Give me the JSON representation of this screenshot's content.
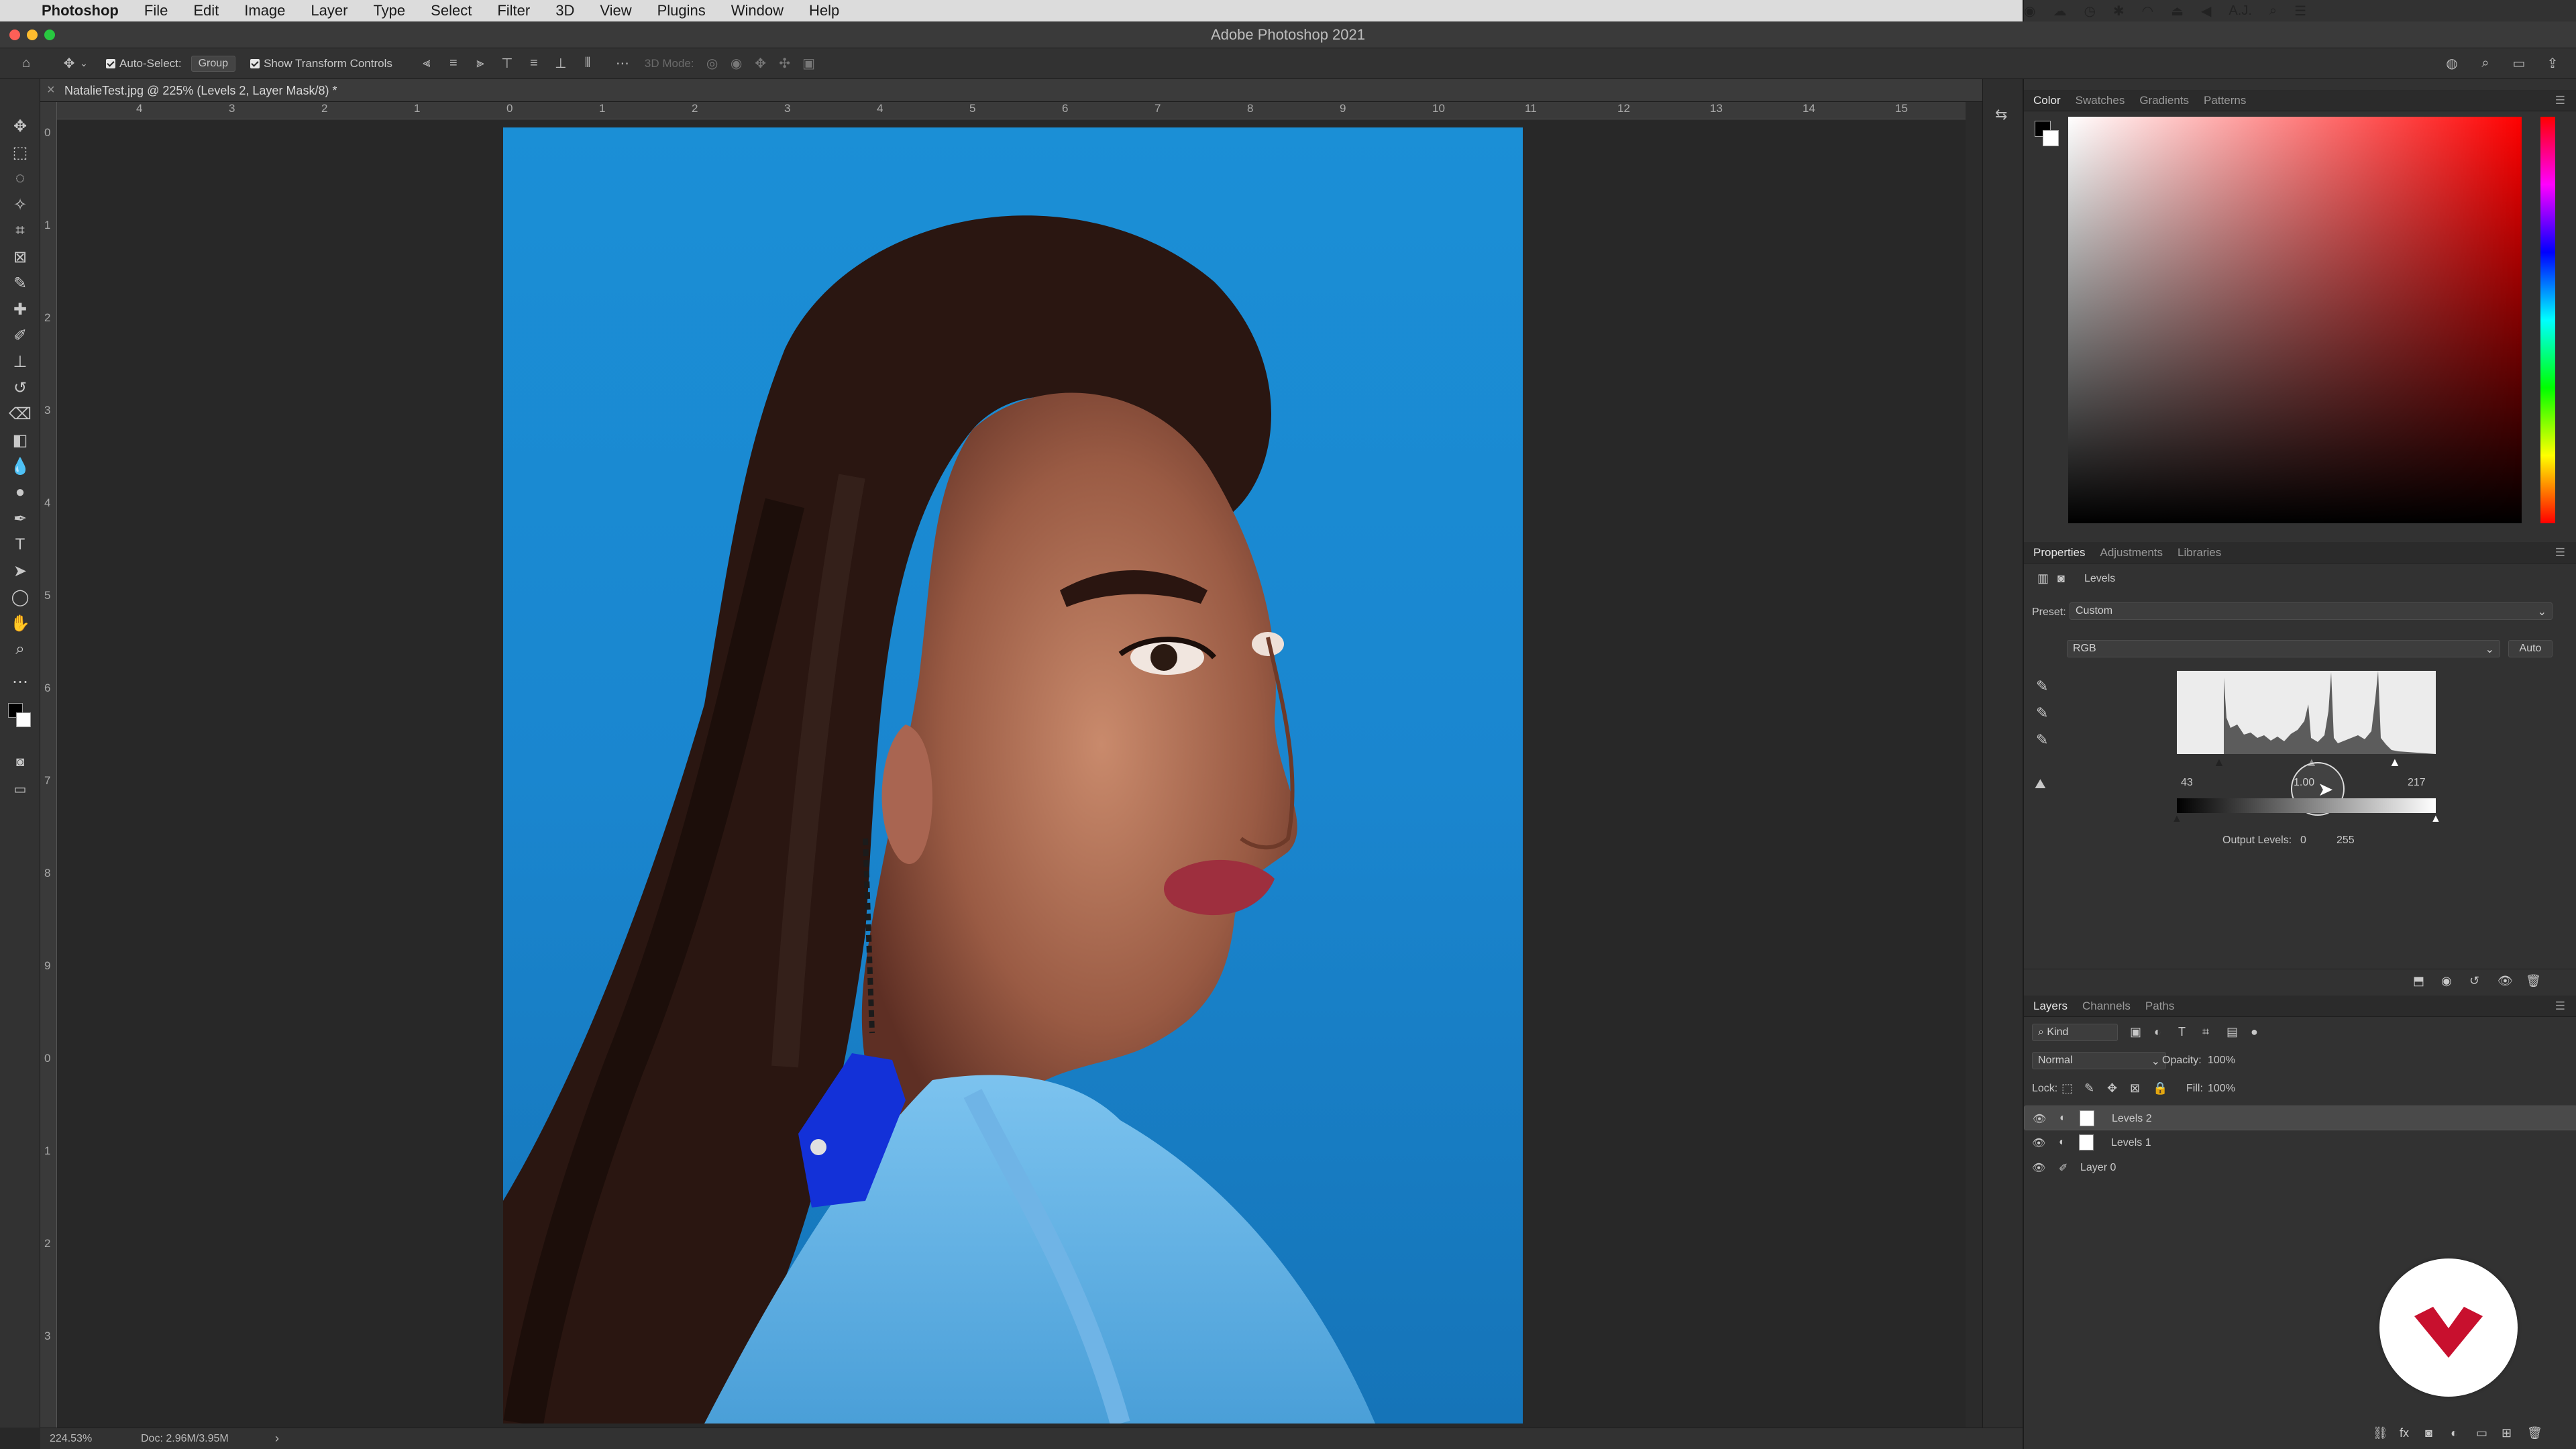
{
  "menubar": {
    "app_name": "Photoshop",
    "items": [
      "File",
      "Edit",
      "Image",
      "Layer",
      "Type",
      "Select",
      "Filter",
      "3D",
      "View",
      "Plugins",
      "Window",
      "Help"
    ],
    "user": "A.J."
  },
  "window": {
    "title": "Adobe Photoshop 2021"
  },
  "options_bar": {
    "auto_select_label": "Auto-Select:",
    "auto_select_target": "Group",
    "show_transform_label": "Show Transform Controls",
    "mode_3d_label": "3D Mode:"
  },
  "document": {
    "tab_title": "NatalieTest.jpg @ 225% (Levels 2, Layer Mask/8) *",
    "zoom": "224.53%",
    "doc_info": "Doc: 2.96M/3.95M"
  },
  "rulers": {
    "h": [
      "4",
      "3",
      "2",
      "1",
      "0",
      "1",
      "2",
      "3",
      "4",
      "5",
      "6",
      "7",
      "8",
      "9",
      "10",
      "11",
      "12",
      "13",
      "14",
      "15"
    ],
    "v": [
      "0",
      "1",
      "2",
      "3",
      "4",
      "5",
      "6",
      "7",
      "8",
      "9",
      "0",
      "1",
      "2",
      "3"
    ]
  },
  "color_panel": {
    "tabs": [
      "Color",
      "Swatches",
      "Gradients",
      "Patterns"
    ],
    "active_tab": "Color",
    "hue_color": "#ff0000"
  },
  "properties_panel": {
    "tabs": [
      "Properties",
      "Adjustments",
      "Libraries"
    ],
    "active_tab": "Properties",
    "adjustment_name": "Levels",
    "preset_label": "Preset:",
    "preset_value": "Custom",
    "channel": "RGB",
    "auto_button": "Auto",
    "input_black": "43",
    "input_gamma": "1.00",
    "input_white": "217",
    "output_label": "Output Levels:",
    "output_black": "0",
    "output_white": "255"
  },
  "layers_panel": {
    "tabs": [
      "Layers",
      "Channels",
      "Paths"
    ],
    "active_tab": "Layers",
    "filter_kind": "Kind",
    "blend_mode": "Normal",
    "opacity_label": "Opacity:",
    "opacity_value": "100%",
    "lock_label": "Lock:",
    "fill_label": "Fill:",
    "fill_value": "100%",
    "layers": [
      {
        "name": "Levels 2",
        "selected": true
      },
      {
        "name": "Levels 1",
        "selected": false
      },
      {
        "name": "Layer 0",
        "selected": false
      }
    ]
  },
  "colors": {
    "accent": "#1a86cf",
    "logo_red": "#c8102e"
  }
}
